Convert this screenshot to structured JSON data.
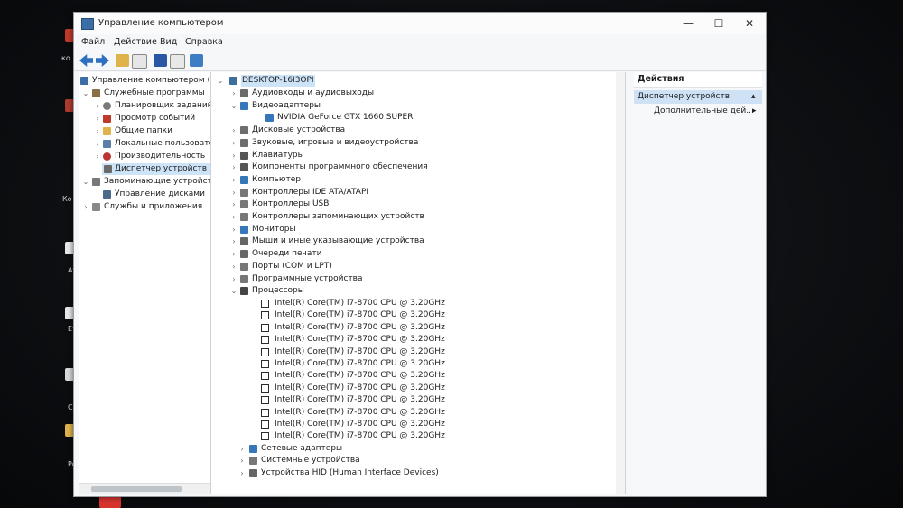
{
  "window": {
    "title": "Управление компьютером",
    "controls": {
      "minimize": "—",
      "maximize": "☐",
      "close": "✕"
    }
  },
  "menu": [
    "Файл",
    "Действие",
    "Вид",
    "Справка"
  ],
  "toolbar": [
    "back-icon",
    "forward-icon",
    "up-folder-icon",
    "show-hide-tree-icon",
    "help-icon",
    "properties-icon",
    "monitor-icon"
  ],
  "left_tree": {
    "root": "Управление компьютером (л",
    "items": [
      {
        "label": "Служебные программы"
      },
      {
        "label": "Планировщик заданий"
      },
      {
        "label": "Просмотр событий"
      },
      {
        "label": "Общие папки"
      },
      {
        "label": "Локальные пользовате"
      },
      {
        "label": "Производительность"
      },
      {
        "label": "Диспетчер устройств"
      },
      {
        "label": "Запоминающие устройст"
      },
      {
        "label": "Управление дисками"
      },
      {
        "label": "Службы и приложения"
      }
    ]
  },
  "device_tree": {
    "root": "DESKTOP-16I3OPI",
    "categories": [
      "Аудиовходы и аудиовыходы",
      "Видеоадаптеры",
      "NVIDIA GeForce GTX 1660 SUPER",
      "Дисковые устройства",
      "Звуковые, игровые и видеоустройства",
      "Клавиатуры",
      "Компоненты программного обеспечения",
      "Компьютер",
      "Контроллеры IDE ATA/ATAPI",
      "Контроллеры USB",
      "Контроллеры запоминающих устройств",
      "Мониторы",
      "Мыши и иные указывающие устройства",
      "Очереди печати",
      "Порты (COM и LPT)",
      "Программные устройства",
      "Процессоры"
    ],
    "cpus": [
      "Intel(R) Core(TM) i7-8700 CPU @ 3.20GHz",
      "Intel(R) Core(TM) i7-8700 CPU @ 3.20GHz",
      "Intel(R) Core(TM) i7-8700 CPU @ 3.20GHz",
      "Intel(R) Core(TM) i7-8700 CPU @ 3.20GHz",
      "Intel(R) Core(TM) i7-8700 CPU @ 3.20GHz",
      "Intel(R) Core(TM) i7-8700 CPU @ 3.20GHz",
      "Intel(R) Core(TM) i7-8700 CPU @ 3.20GHz",
      "Intel(R) Core(TM) i7-8700 CPU @ 3.20GHz",
      "Intel(R) Core(TM) i7-8700 CPU @ 3.20GHz",
      "Intel(R) Core(TM) i7-8700 CPU @ 3.20GHz",
      "Intel(R) Core(TM) i7-8700 CPU @ 3.20GHz",
      "Intel(R) Core(TM) i7-8700 CPU @ 3.20GHz"
    ],
    "after": [
      "Сетевые адаптеры",
      "Системные устройства",
      "Устройства HID (Human Interface Devices)"
    ]
  },
  "actions": {
    "header": "Действия",
    "section": "Диспетчер устройств",
    "more": "Дополнительные дей..."
  },
  "desktop": {
    "snippets": [
      "ко",
      "Ко",
      "Af",
      "Ev",
      "Ch",
      "Po"
    ]
  }
}
